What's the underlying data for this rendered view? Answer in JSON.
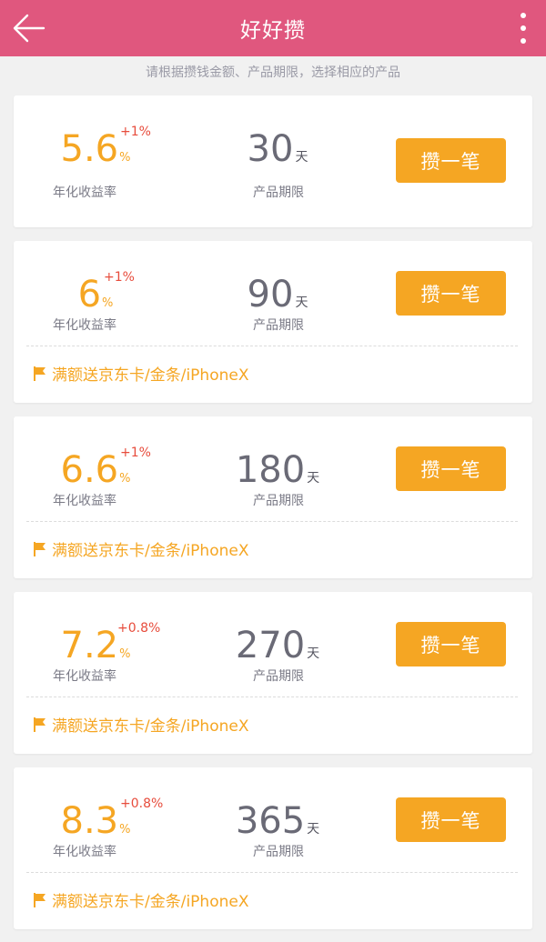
{
  "header": {
    "title": "好好攒"
  },
  "subtitle": "请根据攒钱金额、产品期限，选择相应的产品",
  "colors": {
    "header": "#e0577e",
    "accent": "#f5a623",
    "bonus": "#e74c3c"
  },
  "labels": {
    "rate": "年化收益率",
    "term": "产品期限"
  },
  "products": [
    {
      "rate": "5.6",
      "pct": "%",
      "bonus": "+1%",
      "term": "30",
      "unit": "天",
      "button": "攒一笔",
      "promo": ""
    },
    {
      "rate": "6",
      "pct": "%",
      "bonus": "+1%",
      "term": "90",
      "unit": "天",
      "button": "攒一笔",
      "promo": "满额送京东卡/金条/iPhoneX"
    },
    {
      "rate": "6.6",
      "pct": "%",
      "bonus": "+1%",
      "term": "180",
      "unit": "天",
      "button": "攒一笔",
      "promo": "满额送京东卡/金条/iPhoneX"
    },
    {
      "rate": "7.2",
      "pct": "%",
      "bonus": "+0.8%",
      "term": "270",
      "unit": "天",
      "button": "攒一笔",
      "promo": "满额送京东卡/金条/iPhoneX"
    },
    {
      "rate": "8.3",
      "pct": "%",
      "bonus": "+0.8%",
      "term": "365",
      "unit": "天",
      "button": "攒一笔",
      "promo": "满额送京东卡/金条/iPhoneX"
    }
  ]
}
